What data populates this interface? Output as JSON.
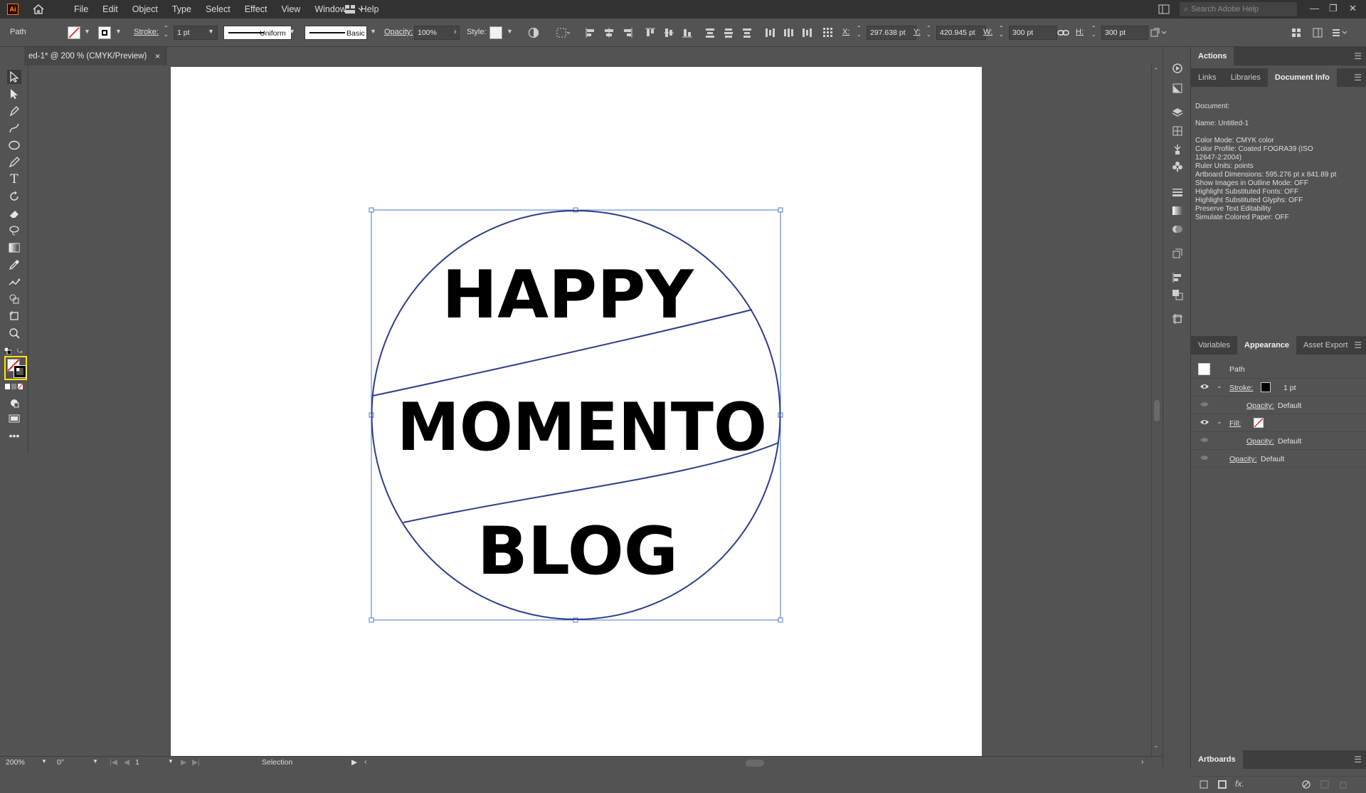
{
  "app": {
    "logo": "Ai",
    "menus": [
      "File",
      "Edit",
      "Object",
      "Type",
      "Select",
      "Effect",
      "View",
      "Window",
      "Help"
    ],
    "search_placeholder": "Search Adobe Help"
  },
  "control": {
    "selection_label": "Path",
    "stroke_label": "Stroke:",
    "stroke_weight": "1 pt",
    "profile": "Uniform",
    "brush": "Basic",
    "opacity_label": "Opacity:",
    "opacity": "100%",
    "style_label": "Style:",
    "x_label": "X:",
    "x": "297.638 pt",
    "y_label": "Y:",
    "y": "420.945 pt",
    "w_label": "W:",
    "w": "300 pt",
    "h_label": "H:",
    "h": "300 pt"
  },
  "document": {
    "tab_title": "ed-1* @ 200 % (CMYK/Preview)",
    "close": "×"
  },
  "artwork": {
    "line1": "HAPPY",
    "line2": "MOMENTO",
    "line3": "BLOG",
    "stroke_color": "#2e3d8a",
    "selection_color": "#4a78c8"
  },
  "panels": {
    "actions_tab": "Actions",
    "tabs_top": [
      "Links",
      "Libraries",
      "Document Info"
    ],
    "docinfo": {
      "doc_label": "Document:",
      "name": "Name: Untitled-1",
      "lines": [
        "Color Mode: CMYK color",
        "Color Profile: Coated FOGRA39 (ISO",
        "12647-2:2004)",
        "Ruler Units: points",
        "Artboard Dimensions: 595.276 pt x 841.89 pt",
        "Show Images in Outline Mode: OFF",
        "Highlight Substituted Fonts: OFF",
        "Highlight Substituted Glyphs: OFF",
        "Preserve Text Editability",
        "Simulate Colored Paper: OFF"
      ]
    },
    "tabs_mid": [
      "Variables",
      "Appearance",
      "Asset Export"
    ],
    "appearance": {
      "object": "Path",
      "stroke_label": "Stroke:",
      "stroke_value": "1 pt",
      "opacity_label": "Opacity:",
      "opacity_value": "Default",
      "fill_label": "Fill:",
      "fill_opacity_label": "Opacity:",
      "fill_opacity_value": "Default",
      "obj_opacity_label": "Opacity:",
      "obj_opacity_value": "Default"
    },
    "artboards_tab": "Artboards"
  },
  "status": {
    "zoom": "200%",
    "rotation": "0°",
    "artboard_num": "1",
    "tool": "Selection"
  }
}
